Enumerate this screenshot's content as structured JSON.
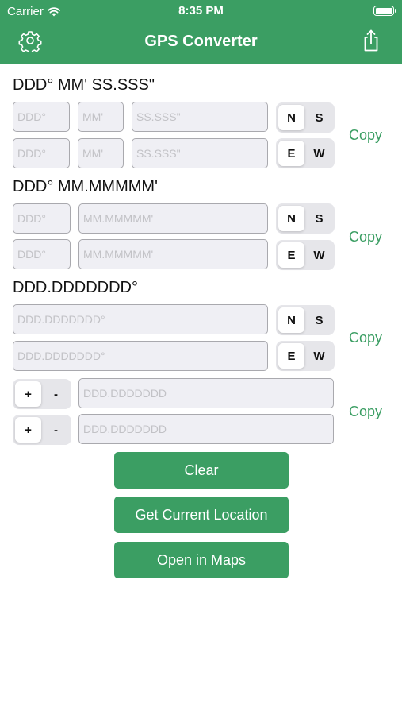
{
  "status": {
    "carrier": "Carrier",
    "time": "8:35 PM",
    "battery_level": 1.0
  },
  "nav": {
    "title": "GPS Converter",
    "settings_icon": "gear-icon",
    "share_icon": "share-icon"
  },
  "dms": {
    "title": "DDD° MM' SS.SSS\"",
    "lat": {
      "deg_ph": "DDD°",
      "min_ph": "MM'",
      "sec_ph": "SS.SSS\"",
      "opt_a": "N",
      "opt_b": "S"
    },
    "lon": {
      "deg_ph": "DDD°",
      "min_ph": "MM'",
      "sec_ph": "SS.SSS\"",
      "opt_a": "E",
      "opt_b": "W"
    },
    "copy": "Copy"
  },
  "dm": {
    "title": "DDD° MM.MMMMM'",
    "lat": {
      "deg_ph": "DDD°",
      "min_ph": "MM.MMMMM'",
      "opt_a": "N",
      "opt_b": "S"
    },
    "lon": {
      "deg_ph": "DDD°",
      "min_ph": "MM.MMMMM'",
      "opt_a": "E",
      "opt_b": "W"
    },
    "copy": "Copy"
  },
  "dd": {
    "title": "DDD.DDDDDDD°",
    "lat": {
      "ph": "DDD.DDDDDDD°",
      "opt_a": "N",
      "opt_b": "S"
    },
    "lon": {
      "ph": "DDD.DDDDDDD°",
      "opt_a": "E",
      "opt_b": "W"
    },
    "copy": "Copy"
  },
  "signed": {
    "lat": {
      "plus": "+",
      "minus": "-",
      "ph": "DDD.DDDDDDD"
    },
    "lon": {
      "plus": "+",
      "minus": "-",
      "ph": "DDD.DDDDDDD"
    },
    "copy": "Copy"
  },
  "buttons": {
    "clear": "Clear",
    "current": "Get Current Location",
    "maps": "Open in Maps"
  },
  "colors": {
    "accent": "#3b9e63",
    "field_bg": "#efeff4",
    "segment_bg": "#e6e6ea"
  }
}
